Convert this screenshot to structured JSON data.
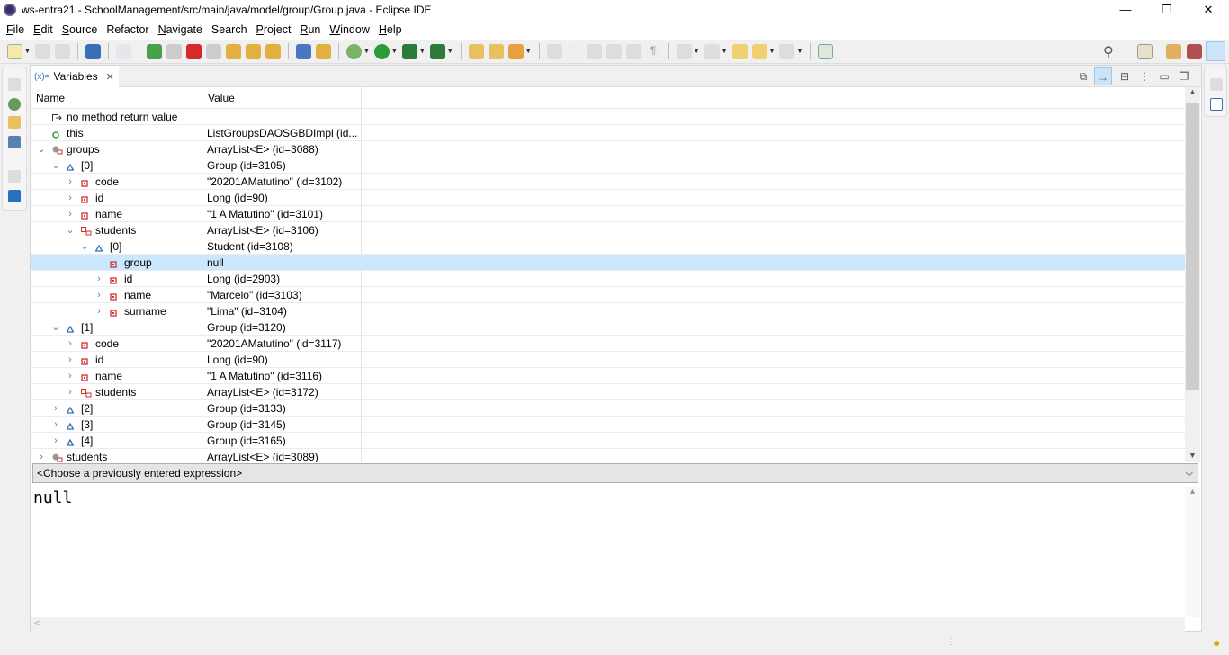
{
  "window": {
    "title": "ws-entra21 - SchoolManagement/src/main/java/model/group/Group.java - Eclipse IDE",
    "minimize": "—",
    "maximize": "❐",
    "close": "✕"
  },
  "menu": [
    {
      "label": "File",
      "u": "F",
      "rest": "ile"
    },
    {
      "label": "Edit",
      "u": "E",
      "rest": "dit"
    },
    {
      "label": "Source",
      "u": "S",
      "rest": "ource"
    },
    {
      "label": "Refactor",
      "u": "",
      "rest": "Refactor"
    },
    {
      "label": "Navigate",
      "u": "N",
      "rest": "avigate"
    },
    {
      "label": "Search",
      "u": "",
      "rest": "Search"
    },
    {
      "label": "Project",
      "u": "P",
      "rest": "roject"
    },
    {
      "label": "Run",
      "u": "R",
      "rest": "un"
    },
    {
      "label": "Window",
      "u": "W",
      "rest": "indow"
    },
    {
      "label": "Help",
      "u": "H",
      "rest": "elp"
    }
  ],
  "view": {
    "tab_icon": "(x)=",
    "tab_label": "Variables",
    "tab_close": "✕"
  },
  "table": {
    "columns": [
      "Name",
      "Value"
    ],
    "rows": [
      {
        "name": "no method return value",
        "value": "",
        "level": 0,
        "state": "none",
        "icon": "return"
      },
      {
        "name": "this",
        "value": "ListGroupsDAOSGBDImpl  (id...",
        "level": 0,
        "state": "none",
        "icon": "local"
      },
      {
        "name": "groups",
        "value": "ArrayList<E>  (id=3088)",
        "level": 0,
        "state": "open",
        "icon": "local-collection"
      },
      {
        "name": "[0]",
        "value": "Group  (id=3105)",
        "level": 1,
        "state": "open",
        "icon": "element"
      },
      {
        "name": "code",
        "value": "\"20201AMatutino\" (id=3102)",
        "level": 2,
        "state": "closed",
        "icon": "field"
      },
      {
        "name": "id",
        "value": "Long  (id=90)",
        "level": 2,
        "state": "closed",
        "icon": "field"
      },
      {
        "name": "name",
        "value": "\"1 A Matutino\" (id=3101)",
        "level": 2,
        "state": "closed",
        "icon": "field"
      },
      {
        "name": "students",
        "value": "ArrayList<E>  (id=3106)",
        "level": 2,
        "state": "open",
        "icon": "field-collection"
      },
      {
        "name": "[0]",
        "value": "Student  (id=3108)",
        "level": 3,
        "state": "open",
        "icon": "element"
      },
      {
        "name": "group",
        "value": "null",
        "level": 4,
        "state": "none",
        "icon": "field",
        "selected": true
      },
      {
        "name": "id",
        "value": "Long  (id=2903)",
        "level": 4,
        "state": "closed",
        "icon": "field"
      },
      {
        "name": "name",
        "value": "\"Marcelo\" (id=3103)",
        "level": 4,
        "state": "closed",
        "icon": "field"
      },
      {
        "name": "surname",
        "value": "\"Lima\" (id=3104)",
        "level": 4,
        "state": "closed",
        "icon": "field"
      },
      {
        "name": "[1]",
        "value": "Group  (id=3120)",
        "level": 1,
        "state": "open",
        "icon": "element"
      },
      {
        "name": "code",
        "value": "\"20201AMatutino\" (id=3117)",
        "level": 2,
        "state": "closed",
        "icon": "field"
      },
      {
        "name": "id",
        "value": "Long  (id=90)",
        "level": 2,
        "state": "closed",
        "icon": "field"
      },
      {
        "name": "name",
        "value": "\"1 A Matutino\" (id=3116)",
        "level": 2,
        "state": "closed",
        "icon": "field"
      },
      {
        "name": "students",
        "value": "ArrayList<E>  (id=3172)",
        "level": 2,
        "state": "closed",
        "icon": "field-collection"
      },
      {
        "name": "[2]",
        "value": "Group  (id=3133)",
        "level": 1,
        "state": "closed",
        "icon": "element"
      },
      {
        "name": "[3]",
        "value": "Group  (id=3145)",
        "level": 1,
        "state": "closed",
        "icon": "element"
      },
      {
        "name": "[4]",
        "value": "Group  (id=3165)",
        "level": 1,
        "state": "closed",
        "icon": "element"
      },
      {
        "name": "students",
        "value": "ArrayList<E>  (id=3089)",
        "level": 0,
        "state": "closed",
        "icon": "local-collection"
      }
    ]
  },
  "expression": {
    "placeholder": "<Choose a previously entered expression>"
  },
  "detail": {
    "value": "null"
  },
  "colors": {
    "selection": "#cce8ff",
    "field": "#d03030",
    "element": "#2f6fb8",
    "local": "#3a9a3a"
  }
}
